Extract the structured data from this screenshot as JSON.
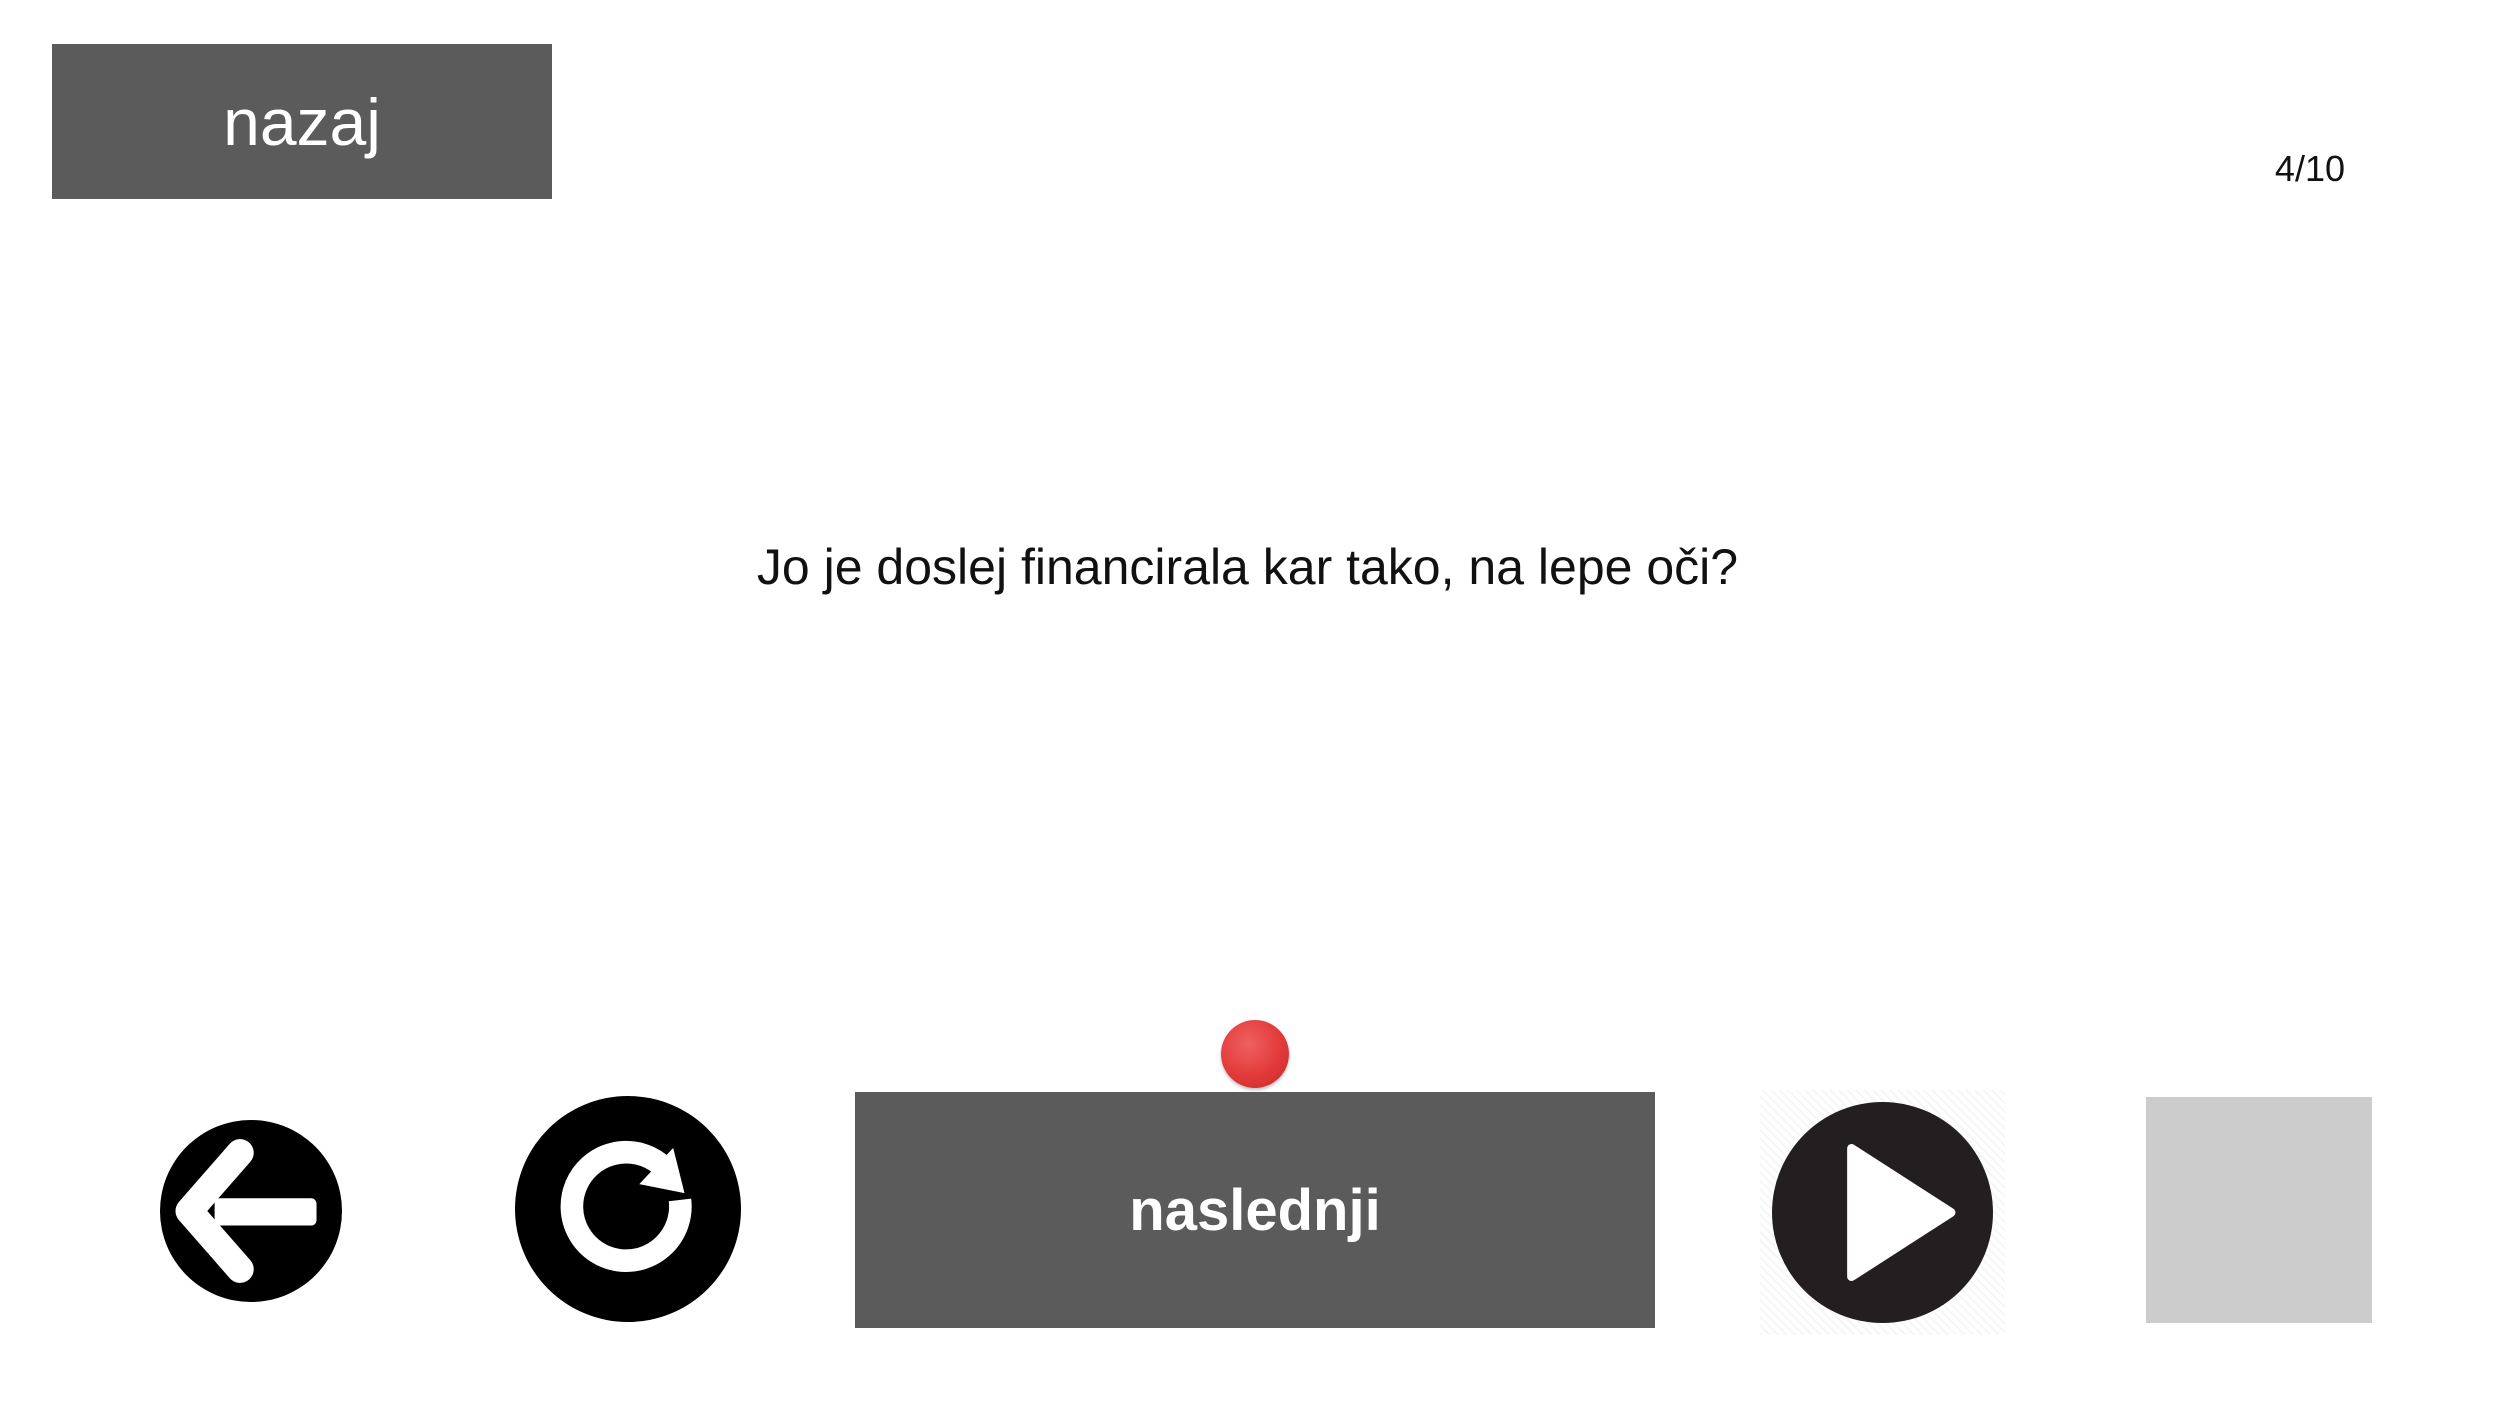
{
  "header": {
    "back_label": "nazaj",
    "progress": "4/10"
  },
  "main": {
    "sentence": "Jo je doslej financirala kar tako, na lepe oči?"
  },
  "controls": {
    "next_label": "naslednji",
    "recording_indicator_color": "#e23a3a"
  },
  "icons": {
    "back": "arrow-left-icon",
    "replay": "replay-icon",
    "play": "play-icon",
    "stop": "stop-icon"
  },
  "colors": {
    "button_bg": "#5b5b5b",
    "icon_bg": "#000000",
    "disabled_bg": "#cccccc"
  }
}
